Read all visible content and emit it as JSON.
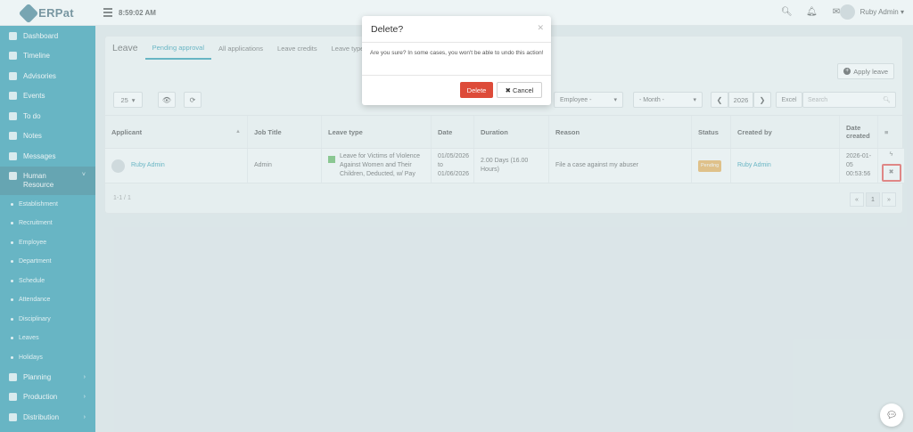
{
  "app": {
    "brand": "ERPat",
    "clock": "8:59:02 AM",
    "user_name": "Ruby Admin ▾"
  },
  "sidebar": {
    "items": [
      {
        "label": "Dashboard"
      },
      {
        "label": "Timeline"
      },
      {
        "label": "Advisories"
      },
      {
        "label": "Events"
      },
      {
        "label": "To do"
      },
      {
        "label": "Notes"
      },
      {
        "label": "Messages"
      }
    ],
    "active": {
      "label_line1": "Human",
      "label_line2": "Resource",
      "chevron": "˅"
    },
    "sub_items": [
      {
        "label": "Establishment"
      },
      {
        "label": "Recruitment"
      },
      {
        "label": "Employee"
      },
      {
        "label": "Department"
      },
      {
        "label": "Schedule"
      },
      {
        "label": "Attendance"
      },
      {
        "label": "Disciplinary"
      },
      {
        "label": "Leaves"
      },
      {
        "label": "Holidays"
      }
    ],
    "bottom_items": [
      {
        "label": "Planning",
        "chevron": "›"
      },
      {
        "label": "Production",
        "chevron": "›"
      },
      {
        "label": "Distribution",
        "chevron": "›"
      }
    ]
  },
  "leave": {
    "title": "Leave",
    "tabs": [
      "Pending approval",
      "All applications",
      "Leave credits",
      "Leave types"
    ],
    "apply_label": "Apply leave",
    "page_size": "25",
    "employee_filter": "Employee -",
    "month_filter": "- Month -",
    "year": "2026",
    "excel_label": "Excel",
    "search_placeholder": "Search",
    "headers": [
      "Applicant",
      "Job Title",
      "Leave type",
      "Date",
      "Duration",
      "Reason",
      "Status",
      "Created by",
      "Date created",
      "≡"
    ],
    "row": {
      "applicant": "Ruby Admin",
      "job_title": "Admin",
      "leave_type": "Leave for Victims of Violence Against Women and Their Children, Deducted, w/ Pay",
      "date": "01/05/2026 to 01/06/2026",
      "duration": "2.00 Days (16.00 Hours)",
      "reason": "File a case against my abuser",
      "status": "Pending",
      "created_by": "Ruby Admin",
      "date_created": "2026-01-05 00:53:56"
    },
    "pagination_info": "1-1 / 1",
    "pages": [
      "«",
      "1",
      "»"
    ]
  },
  "modal": {
    "title": "Delete?",
    "body": "Are you sure? In some cases, you won't be able to undo this action!",
    "delete_label": "Delete",
    "cancel_label": "Cancel"
  },
  "colors": {
    "sidebar": "#0e8da6",
    "accent": "#0e8da6",
    "danger": "#dd4b39",
    "pending": "#e6a23c"
  }
}
